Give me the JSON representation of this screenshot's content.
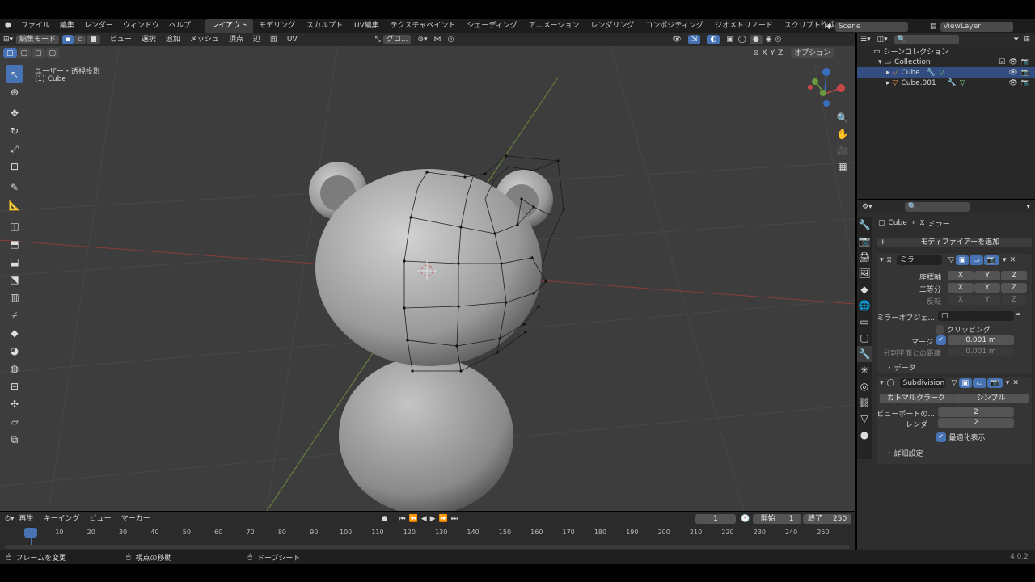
{
  "menu": {
    "items": [
      "ファイル",
      "編集",
      "レンダー",
      "ウィンドウ",
      "ヘルプ"
    ],
    "workspaces": [
      "レイアウト",
      "モデリング",
      "スカルプト",
      "UV編集",
      "テクスチャペイント",
      "シェーディング",
      "アニメーション",
      "レンダリング",
      "コンポジティング",
      "ジオメトリノード",
      "スクリプト作成"
    ],
    "active_workspace": "レイアウト",
    "scene": "Scene",
    "view_layer": "ViewLayer"
  },
  "viewport": {
    "mode": "編集モード",
    "menus": [
      "ビュー",
      "選択",
      "追加",
      "メッシュ",
      "頂点",
      "辺",
      "面",
      "UV"
    ],
    "transform": "グロ...",
    "overlay_title": "ユーザー・透視投影",
    "overlay_object": "(1) Cube",
    "axis_labels": [
      "X",
      "Y",
      "Z"
    ],
    "options_label": "オプション"
  },
  "outliner": {
    "title": "シーンコレクション",
    "items": [
      {
        "label": "Collection"
      },
      {
        "label": "Cube"
      },
      {
        "label": "Cube.001"
      }
    ]
  },
  "properties": {
    "breadcrumb_object": "Cube",
    "breadcrumb_modifier": "ミラー",
    "add_modifier": "モディファイアーを追加",
    "mirror": {
      "name": "ミラー",
      "axis_label": "座標軸",
      "bisect_label": "二等分",
      "flip_label": "反転",
      "axes": [
        "X",
        "Y",
        "Z"
      ],
      "mirror_object_label": "ミラーオブジェ...",
      "clipping_label": "クリッピング",
      "merge_label": "マージ",
      "merge_value": "0.001 m",
      "bisect_distance_label": "分割平面との距離",
      "bisect_distance_value": "0.001 m",
      "data_label": "データ"
    },
    "subdivision": {
      "name": "Subdivision",
      "tab_catmull": "カトマルクラーク",
      "tab_simple": "シンプル",
      "viewport_label": "ビューポートの...",
      "viewport_value": "2",
      "render_label": "レンダー",
      "render_value": "2",
      "optimal_label": "最適化表示",
      "advanced_label": "詳細設定"
    }
  },
  "timeline": {
    "menus": [
      "再生",
      "キーイング",
      "ビュー",
      "マーカー"
    ],
    "current_frame": "1",
    "start_label": "開始",
    "start_value": "1",
    "end_label": "終了",
    "end_value": "250",
    "ticks": [
      "1",
      "10",
      "20",
      "30",
      "40",
      "50",
      "60",
      "70",
      "80",
      "90",
      "100",
      "110",
      "120",
      "130",
      "140",
      "150",
      "160",
      "170",
      "180",
      "190",
      "200",
      "210",
      "220",
      "230",
      "240",
      "250"
    ]
  },
  "status": {
    "items": [
      "フレームを変更",
      "視点の移動",
      "ドープシート"
    ],
    "version": "4.0.2"
  }
}
